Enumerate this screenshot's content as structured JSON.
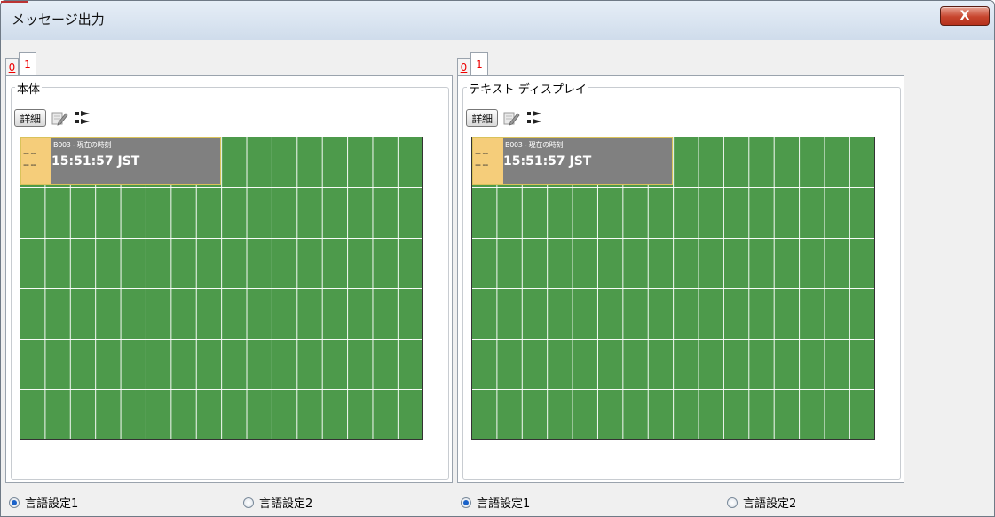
{
  "window": {
    "title": "メッセージ出力",
    "close_label": "X"
  },
  "panels": [
    {
      "tabs": [
        "0",
        "1"
      ],
      "group_title": "本体",
      "toolbar": {
        "detail_label": "詳細"
      },
      "message": {
        "code": "B003 - 現在の時刻",
        "time": "15:51:57 JST",
        "marker": "-- --\n-- --"
      },
      "radios": [
        {
          "label": "言語設定1",
          "checked": true
        },
        {
          "label": "言語設定2",
          "checked": false
        }
      ]
    },
    {
      "tabs": [
        "0",
        "1"
      ],
      "group_title": "テキスト ディスプレイ",
      "toolbar": {
        "detail_label": "詳細"
      },
      "message": {
        "code": "B003 - 現在の時刻",
        "time": "15:51:57 JST",
        "marker": "-- --\n-- --"
      },
      "radios": [
        {
          "label": "言語設定1",
          "checked": true
        },
        {
          "label": "言語設定2",
          "checked": false
        }
      ]
    }
  ],
  "colors": {
    "display_background": "#4d9a4b",
    "grid_lines": "#ffffff",
    "message_cell": "#808080",
    "marker": "#f5cd7a",
    "tab_text": "#e00000"
  },
  "icons": [
    "edit-icon",
    "move-icon",
    "close-icon",
    "radio-checked-icon",
    "radio-unchecked-icon"
  ]
}
